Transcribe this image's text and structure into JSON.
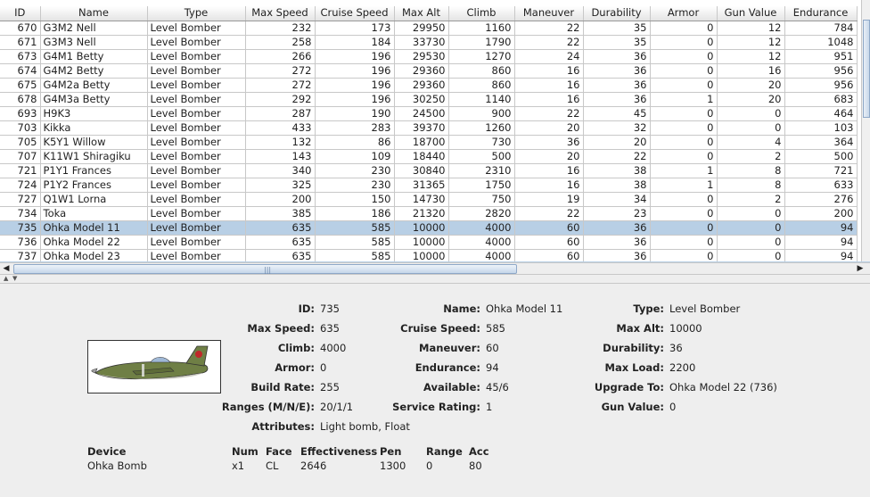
{
  "table": {
    "columns": [
      "ID",
      "Name",
      "Type",
      "Max Speed",
      "Cruise Speed",
      "Max Alt",
      "Climb",
      "Maneuver",
      "Durability",
      "Armor",
      "Gun Value",
      "Endurance"
    ],
    "rows": [
      [
        "670",
        "G3M2 Nell",
        "Level Bomber",
        "232",
        "173",
        "29950",
        "1160",
        "22",
        "35",
        "0",
        "12",
        "784"
      ],
      [
        "671",
        "G3M3 Nell",
        "Level Bomber",
        "258",
        "184",
        "33730",
        "1790",
        "22",
        "35",
        "0",
        "12",
        "1048"
      ],
      [
        "673",
        "G4M1 Betty",
        "Level Bomber",
        "266",
        "196",
        "29530",
        "1270",
        "24",
        "36",
        "0",
        "12",
        "951"
      ],
      [
        "674",
        "G4M2 Betty",
        "Level Bomber",
        "272",
        "196",
        "29360",
        "860",
        "16",
        "36",
        "0",
        "16",
        "956"
      ],
      [
        "675",
        "G4M2a Betty",
        "Level Bomber",
        "272",
        "196",
        "29360",
        "860",
        "16",
        "36",
        "0",
        "20",
        "956"
      ],
      [
        "678",
        "G4M3a Betty",
        "Level Bomber",
        "292",
        "196",
        "30250",
        "1140",
        "16",
        "36",
        "1",
        "20",
        "683"
      ],
      [
        "693",
        "H9K3",
        "Level Bomber",
        "287",
        "190",
        "24500",
        "900",
        "22",
        "45",
        "0",
        "0",
        "464"
      ],
      [
        "703",
        "Kikka",
        "Level Bomber",
        "433",
        "283",
        "39370",
        "1260",
        "20",
        "32",
        "0",
        "0",
        "103"
      ],
      [
        "705",
        "K5Y1 Willow",
        "Level Bomber",
        "132",
        "86",
        "18700",
        "730",
        "36",
        "20",
        "0",
        "4",
        "364"
      ],
      [
        "707",
        "K11W1 Shiragiku",
        "Level Bomber",
        "143",
        "109",
        "18440",
        "500",
        "20",
        "22",
        "0",
        "2",
        "500"
      ],
      [
        "721",
        "P1Y1 Frances",
        "Level Bomber",
        "340",
        "230",
        "30840",
        "2310",
        "16",
        "38",
        "1",
        "8",
        "721"
      ],
      [
        "724",
        "P1Y2 Frances",
        "Level Bomber",
        "325",
        "230",
        "31365",
        "1750",
        "16",
        "38",
        "1",
        "8",
        "633"
      ],
      [
        "727",
        "Q1W1 Lorna",
        "Level Bomber",
        "200",
        "150",
        "14730",
        "750",
        "19",
        "34",
        "0",
        "2",
        "276"
      ],
      [
        "734",
        "Toka",
        "Level Bomber",
        "385",
        "186",
        "21320",
        "2820",
        "22",
        "23",
        "0",
        "0",
        "200"
      ],
      [
        "735",
        "Ohka Model 11",
        "Level Bomber",
        "635",
        "585",
        "10000",
        "4000",
        "60",
        "36",
        "0",
        "0",
        "94"
      ],
      [
        "736",
        "Ohka Model 22",
        "Level Bomber",
        "635",
        "585",
        "10000",
        "4000",
        "60",
        "36",
        "0",
        "0",
        "94"
      ],
      [
        "737",
        "Ohka Model 23",
        "Level Bomber",
        "635",
        "585",
        "10000",
        "4000",
        "60",
        "36",
        "0",
        "0",
        "94"
      ]
    ],
    "selected_index": 14
  },
  "scroll": {
    "left_arrow": "◀",
    "right_arrow": "▶",
    "grip": "|||"
  },
  "detail": {
    "id_label": "ID:",
    "id_value": "735",
    "name_label": "Name:",
    "name_value": "Ohka Model 11",
    "type_label": "Type:",
    "type_value": "Level Bomber",
    "max_speed_label": "Max Speed:",
    "max_speed_value": "635",
    "cruise_speed_label": "Cruise Speed:",
    "cruise_speed_value": "585",
    "max_alt_label": "Max Alt:",
    "max_alt_value": "10000",
    "climb_label": "Climb:",
    "climb_value": "4000",
    "maneuver_label": "Maneuver:",
    "maneuver_value": "60",
    "durability_label": "Durability:",
    "durability_value": "36",
    "armor_label": "Armor:",
    "armor_value": "0",
    "endurance_label": "Endurance:",
    "endurance_value": "94",
    "max_load_label": "Max Load:",
    "max_load_value": "2200",
    "build_rate_label": "Build Rate:",
    "build_rate_value": "255",
    "available_label": "Available:",
    "available_value": "45/6",
    "upgrade_label": "Upgrade To:",
    "upgrade_value": "Ohka Model 22 (736)",
    "ranges_label": "Ranges (M/N/E):",
    "ranges_value": "20/1/1",
    "service_label": "Service Rating:",
    "service_value": "1",
    "gun_value_label": "Gun Value:",
    "gun_value_value": "0",
    "attributes_label": "Attributes:",
    "attributes_value": "Light bomb, Float"
  },
  "device": {
    "headers": {
      "device": "Device",
      "num": "Num",
      "face": "Face",
      "effectiveness": "Effectiveness",
      "pen": "Pen",
      "range": "Range",
      "acc": "Acc"
    },
    "row": {
      "device": "Ohka Bomb",
      "num": "x1",
      "face": "CL",
      "effectiveness": "2646",
      "pen": "1300",
      "range": "0",
      "acc": "80"
    }
  },
  "colors": {
    "selection": "#b8cfe5",
    "grid_line": "#c8c8c8",
    "panel_bg": "#eeeeee"
  }
}
